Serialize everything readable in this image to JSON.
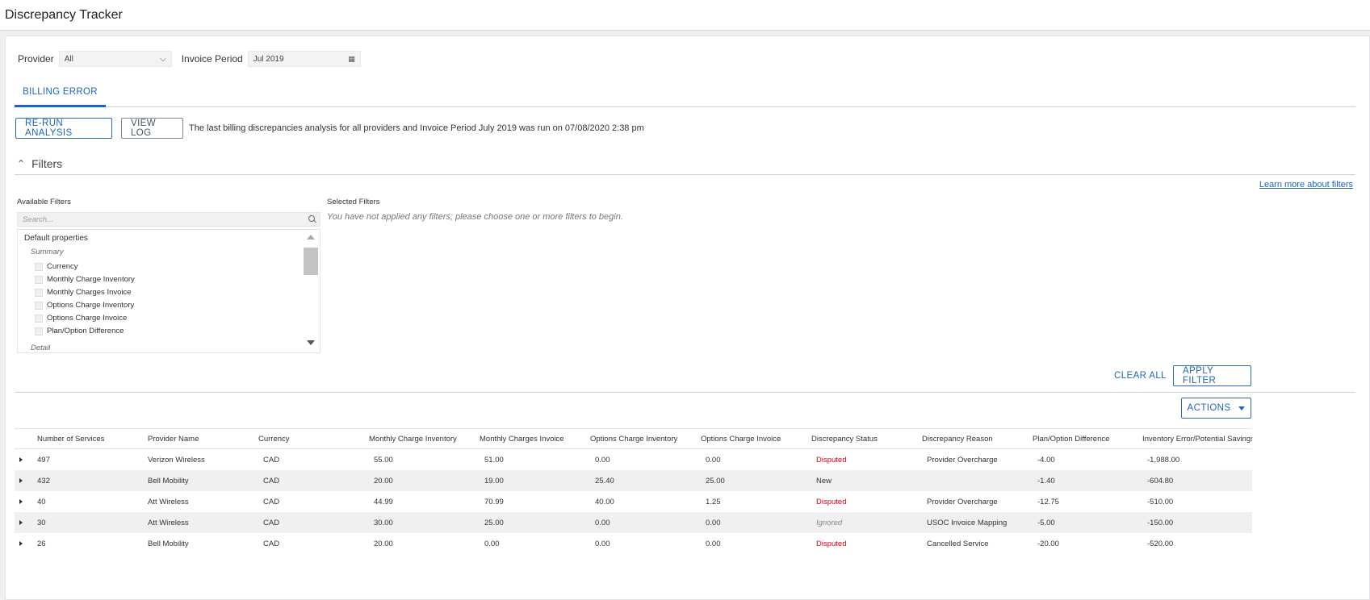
{
  "app": {
    "title": "Discrepancy Tracker"
  },
  "filterbar": {
    "provider_label": "Provider",
    "provider_value": "All",
    "period_label": "Invoice Period",
    "period_value": "Jul 2019"
  },
  "tabs": [
    {
      "label": "BILLING ERROR",
      "active": true
    }
  ],
  "actions": {
    "rerun_label": "RE-RUN ANALYSIS",
    "viewlog_label": "VIEW LOG",
    "message": "The last billing discrepancies analysis for all providers and Invoice Period July 2019 was run on 07/08/2020 2:38 pm"
  },
  "filters": {
    "title": "Filters",
    "learn_more": "Learn more about filters",
    "available_label": "Available Filters",
    "selected_label": "Selected Filters",
    "selected_empty": "You have not applied any filters; please choose one or more filters to begin.",
    "search_placeholder": "Search...",
    "list_heading": "Default properties",
    "group_summary": "Summary",
    "group_detail": "Detail",
    "items": [
      "Currency",
      "Monthly Charge Inventory",
      "Monthly Charges Invoice",
      "Options Charge Inventory",
      "Options Charge Invoice",
      "Plan/Option Difference"
    ],
    "clear_all": "CLEAR ALL",
    "apply": "APPLY FILTER"
  },
  "table_actions": {
    "label": "ACTIONS"
  },
  "table": {
    "columns": [
      "Number of Services",
      "Provider Name",
      "Currency",
      "Monthly Charge Inventory",
      "Monthly Charges Invoice",
      "Options Charge Inventory",
      "Options Charge Invoice",
      "Discrepancy Status",
      "Discrepancy Reason",
      "Plan/Option Difference",
      "Inventory Error/Potential Savings"
    ],
    "rows": [
      [
        "497",
        "Verizon Wireless",
        "CAD",
        "55.00",
        "51.00",
        "0.00",
        "0.00",
        "Disputed",
        "Provider Overcharge",
        "-4.00",
        "-1,988.00"
      ],
      [
        "432",
        "Bell Mobility",
        "CAD",
        "20.00",
        "19.00",
        "25.40",
        "25.00",
        "New",
        "",
        "-1.40",
        "-604.80"
      ],
      [
        "40",
        "Att Wireless",
        "CAD",
        "44.99",
        "70.99",
        "40.00",
        "1.25",
        "Disputed",
        "Provider Overcharge",
        "-12.75",
        "-510.00"
      ],
      [
        "30",
        "Att Wireless",
        "CAD",
        "30.00",
        "25.00",
        "0.00",
        "0.00",
        "Ignored",
        "USOC Invoice Mapping",
        "-5.00",
        "-150.00"
      ],
      [
        "26",
        "Bell Mobility",
        "CAD",
        "20.00",
        "0.00",
        "0.00",
        "0.00",
        "Disputed",
        "Cancelled Service",
        "-20.00",
        "-520.00"
      ]
    ]
  },
  "colors": {
    "accent": "#1f66b8",
    "disputed": "#d0021b"
  }
}
